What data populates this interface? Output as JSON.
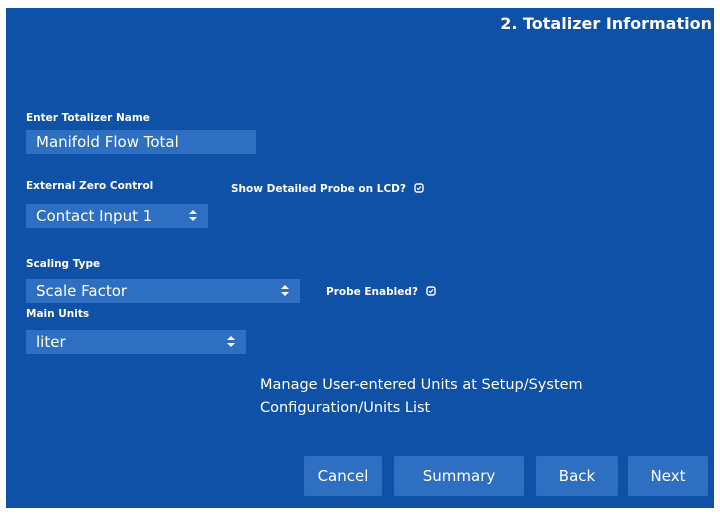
{
  "header": {
    "title": "2. Totalizer Information"
  },
  "totalizer_name": {
    "label": "Enter Totalizer Name",
    "value": "Manifold Flow Total"
  },
  "external_zero": {
    "label": "External Zero Control",
    "value": "Contact Input 1"
  },
  "show_probe": {
    "label": "Show Detailed Probe on LCD?"
  },
  "scaling_type": {
    "label": "Scaling Type",
    "value": "Scale Factor"
  },
  "probe_enabled": {
    "label": "Probe Enabled?"
  },
  "main_units": {
    "label": "Main Units",
    "value": "liter"
  },
  "note": {
    "text": "Manage User-entered Units at Setup/System Configuration/Units List"
  },
  "buttons": {
    "cancel": "Cancel",
    "summary": "Summary",
    "back": "Back",
    "next": "Next"
  },
  "colors": {
    "panel": "#0f51a6",
    "field": "#2f6fc2",
    "text": "#ffffff"
  },
  "icons": {
    "checkbox": "checkbox-icon",
    "select": "select-arrows-icon"
  }
}
